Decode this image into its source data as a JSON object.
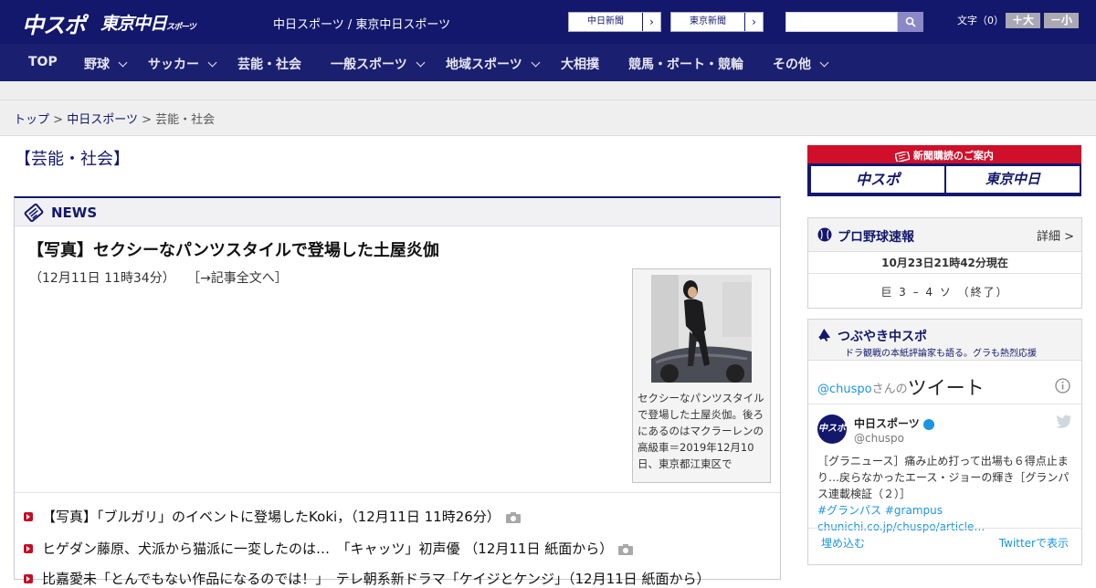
{
  "header": {
    "logo_chuspo": "中スポ",
    "logo_tokyo": "東京中日",
    "logo_tokyo_small": "スポーツ",
    "site_links": "中日スポーツ / 東京中日スポーツ",
    "paper_buttons": [
      "中日新聞",
      "東京新聞"
    ],
    "search_placeholder": "",
    "font_size_label": "文字（0）",
    "font_larger": "＋大",
    "font_smaller": "－小"
  },
  "nav": {
    "items": [
      {
        "label": "TOP",
        "dropdown": false
      },
      {
        "label": "野球",
        "dropdown": true
      },
      {
        "label": "サッカー",
        "dropdown": true
      },
      {
        "label": "芸能・社会",
        "dropdown": false
      },
      {
        "label": "一般スポーツ",
        "dropdown": true
      },
      {
        "label": "地域スポーツ",
        "dropdown": true
      },
      {
        "label": "大相撲",
        "dropdown": false
      },
      {
        "label": "競馬・ボート・競輪",
        "dropdown": false
      },
      {
        "label": "その他",
        "dropdown": true
      }
    ]
  },
  "breadcrumb": {
    "items": [
      "トップ",
      "中日スポーツ",
      "芸能・社会"
    ],
    "separator": ">"
  },
  "page_title": "【芸能・社会】",
  "news": {
    "label": "NEWS",
    "article_title": "【写真】セクシーなパンツスタイルで登場した土屋炎伽",
    "article_time": "（12月11日 11時34分）",
    "article_link": "［→記事全文へ］",
    "photo_caption": "セクシーなパンツスタイルで登場した土屋炎伽。後ろにあるのはマクラーレンの高級車＝2019年12月10日、東京都江東区で",
    "items": [
      {
        "text": "【写真】「ブルガリ」のイベントに登場したKoki，（12月11日 11時26分）",
        "has_photo": true
      },
      {
        "text": "ヒゲダン藤原、犬派から猫派に一変したのは…　「キャッツ」初声優 （12月11日 紙面から）",
        "has_photo": true
      },
      {
        "text": "比嘉愛未「とんでもない作品になるのでは！」　テレ朝系新ドラマ「ケイジとケンジ」（12月11日 紙面から）",
        "has_photo": false
      }
    ]
  },
  "sidebar": {
    "subscription_label": "新聞購読のご案内",
    "subscription_logos": [
      "中スポ",
      "東京中日"
    ],
    "scores": {
      "title": "プロ野球速報",
      "detail": "詳細 >",
      "timestamp": "10月23日21時42分現在",
      "result": "巨 3 – 4 ソ （終了）"
    },
    "tweets": {
      "title": "つぶやき中スポ",
      "subtitle": "ドラ観戦の本紙評論家も語る。グラも熱烈応援",
      "header_handle": "@chuspo",
      "header_san": "さんの",
      "header_tweet": "ツイート",
      "avatar_text": "中スポ",
      "account_name": "中日スポーツ",
      "account_handle": "@chuspo",
      "body": "［グラニュース］痛み止め打って出場も６得点止まり…戻らなかったエース・ジョーの輝き［グランパス連載検証（２）］",
      "hashtags": "#グランパス #grampus",
      "link": "chunichi.co.jp/chuspo/article…",
      "embed": "埋め込む",
      "view_on_twitter": "Twitterで表示"
    }
  },
  "colors": {
    "navy": "#13186c",
    "nav_bg": "#1b1f6f",
    "accent_red": "#c30d23",
    "twitter_blue": "#1b95e0"
  }
}
